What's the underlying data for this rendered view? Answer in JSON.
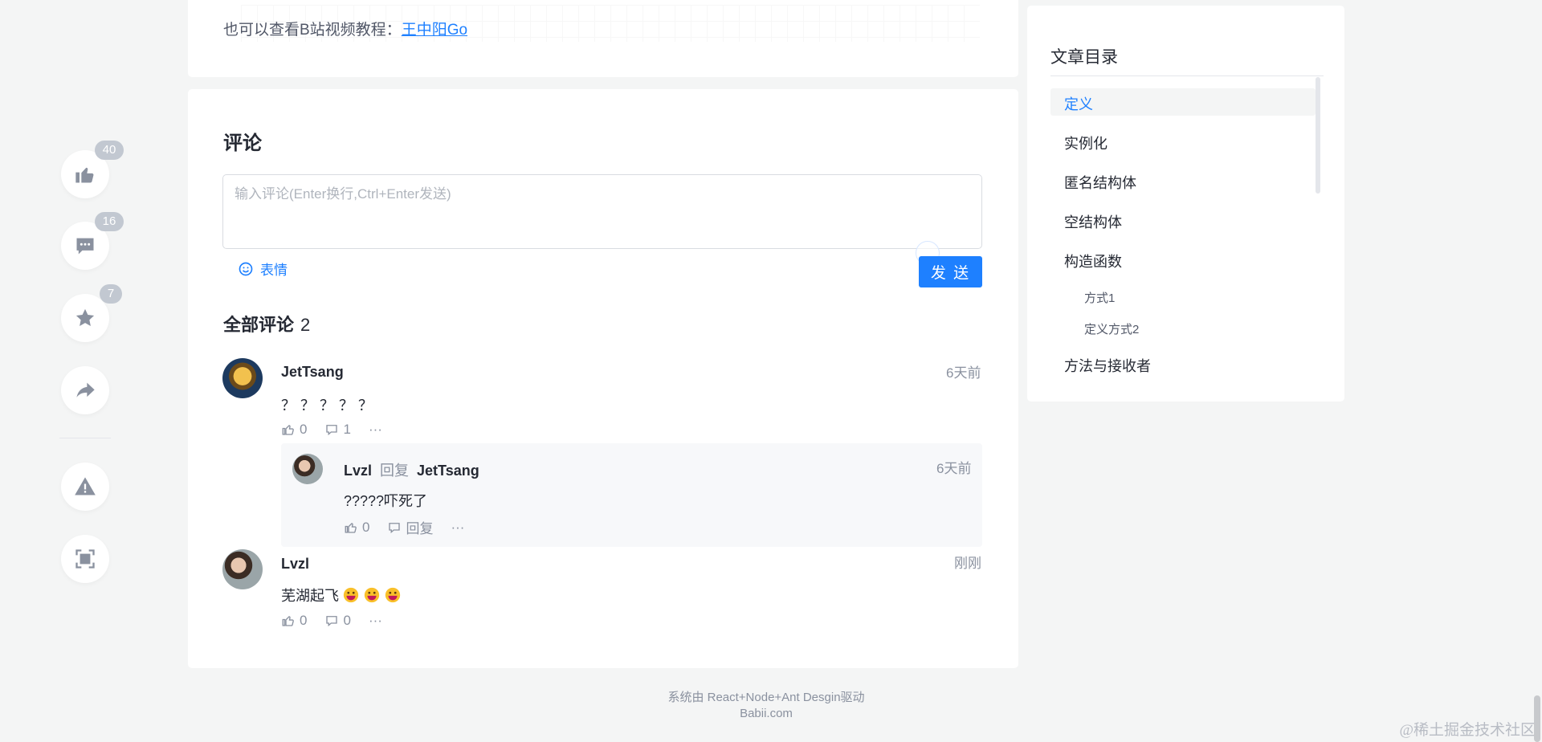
{
  "rail": {
    "like_count": "40",
    "comment_count": "16",
    "collect_count": "7"
  },
  "article_tail": {
    "text": "也可以查看B站视频教程：",
    "link": "王中阳Go"
  },
  "comments": {
    "title": "评论",
    "input_placeholder": "输入评论(Enter换行,Ctrl+Enter发送)",
    "emoji_label": "表情",
    "send_label": "发 送",
    "all_label": "全部评论",
    "all_count": "2",
    "items": [
      {
        "author": "JetTsang",
        "time": "6天前",
        "content": "？？？？？",
        "likes": "0",
        "replies": "1",
        "more": "···",
        "reply": {
          "author": "Lvzl",
          "reply_word": "回复",
          "target": "JetTsang",
          "time": "6天前",
          "content": "?????吓死了",
          "likes": "0",
          "reply_label": "回复",
          "more": "···"
        }
      },
      {
        "author": "Lvzl",
        "time": "刚刚",
        "content": "芜湖起飞",
        "likes": "0",
        "replies": "0",
        "more": "···"
      }
    ]
  },
  "toc": {
    "title": "文章目录",
    "items": [
      "定义",
      "实例化",
      "匿名结构体",
      "空结构体",
      "构造函数",
      "方式1",
      "定义方式2",
      "方法与接收者"
    ]
  },
  "footer": {
    "line1": "系统由 React+Node+Ant Desgin驱动",
    "line2": "Babii.com"
  },
  "watermark": "@稀土掘金技术社区",
  "colors": {
    "accent": "#1e80ff",
    "badge": "#c2c8d1",
    "page_bg": "#f4f5f5"
  }
}
